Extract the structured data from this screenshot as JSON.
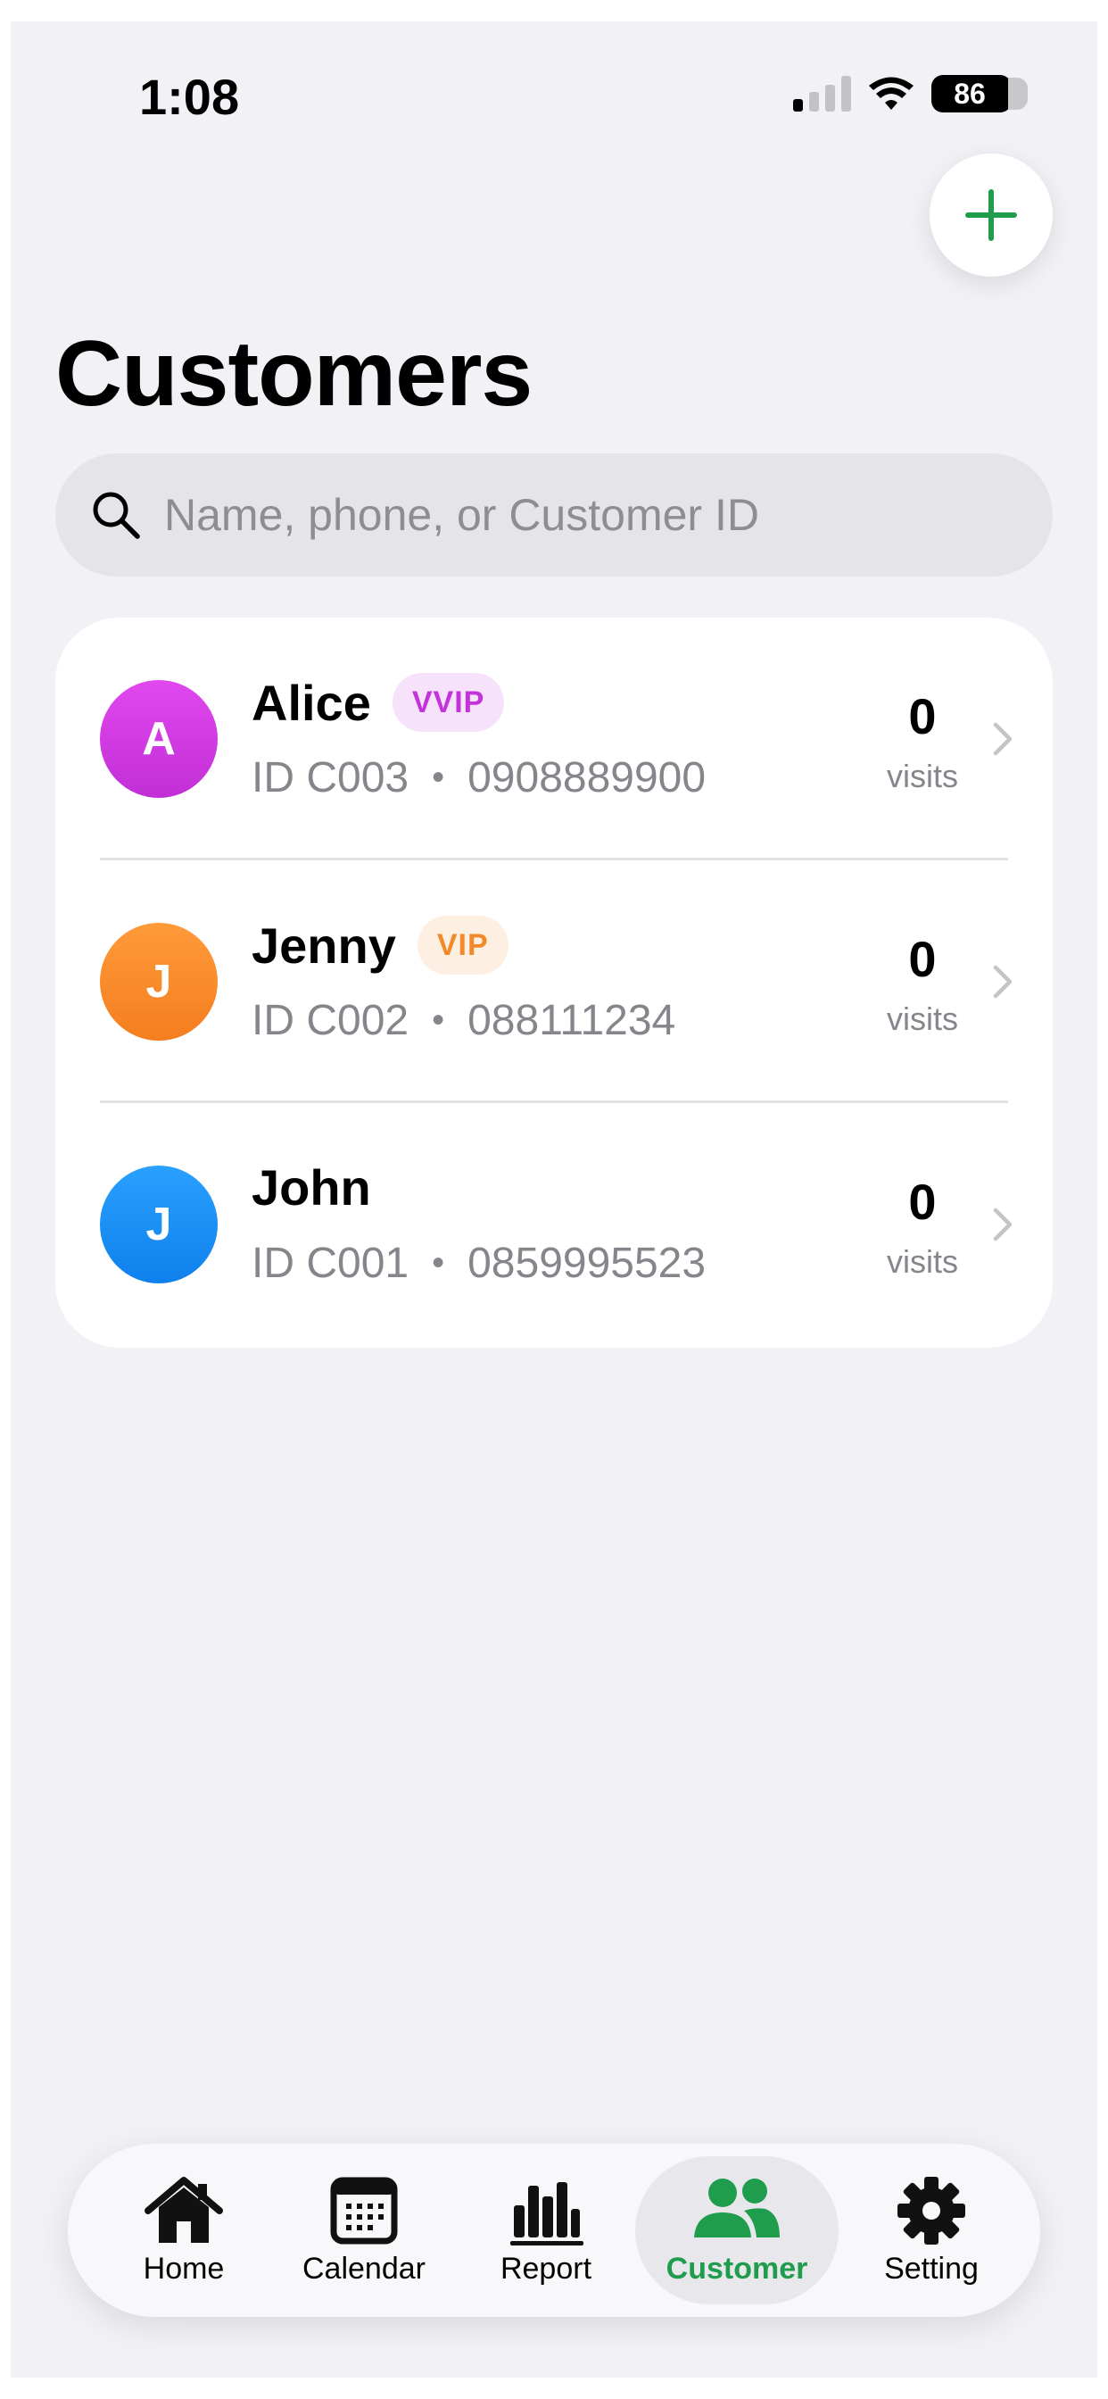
{
  "status_bar": {
    "time": "1:08",
    "battery": "86"
  },
  "header": {
    "title": "Customers",
    "add_label": "+"
  },
  "search": {
    "placeholder": "Name, phone, or Customer ID"
  },
  "customers": [
    {
      "initial": "A",
      "name": "Alice",
      "badge": "VVIP",
      "id_text": "ID C003",
      "phone": "0908889900",
      "visits_count": "0",
      "visits_label": "visits"
    },
    {
      "initial": "J",
      "name": "Jenny",
      "badge": "VIP",
      "id_text": "ID C002",
      "phone": "088111234",
      "visits_count": "0",
      "visits_label": "visits"
    },
    {
      "initial": "J",
      "name": "John",
      "badge": "",
      "id_text": "ID C001",
      "phone": "0859995523",
      "visits_count": "0",
      "visits_label": "visits"
    }
  ],
  "meta_separator": "•",
  "tabs": [
    {
      "label": "Home",
      "icon": "house-icon"
    },
    {
      "label": "Calendar",
      "icon": "calendar-icon"
    },
    {
      "label": "Report",
      "icon": "bar-chart-icon"
    },
    {
      "label": "Customer",
      "icon": "people-icon",
      "active": true
    },
    {
      "label": "Setting",
      "icon": "gear-icon"
    }
  ],
  "colors": {
    "accent": "#1f9d4d",
    "vvip_badge_bg": "#f6e2fb",
    "vvip_badge_text": "#c234d9",
    "vip_badge_bg": "#fdefe1",
    "vip_badge_text": "#f08a2b",
    "avatar_alice": "#cf36e0",
    "avatar_jenny": "#fb8a2a",
    "avatar_john": "#1b8ff5"
  }
}
